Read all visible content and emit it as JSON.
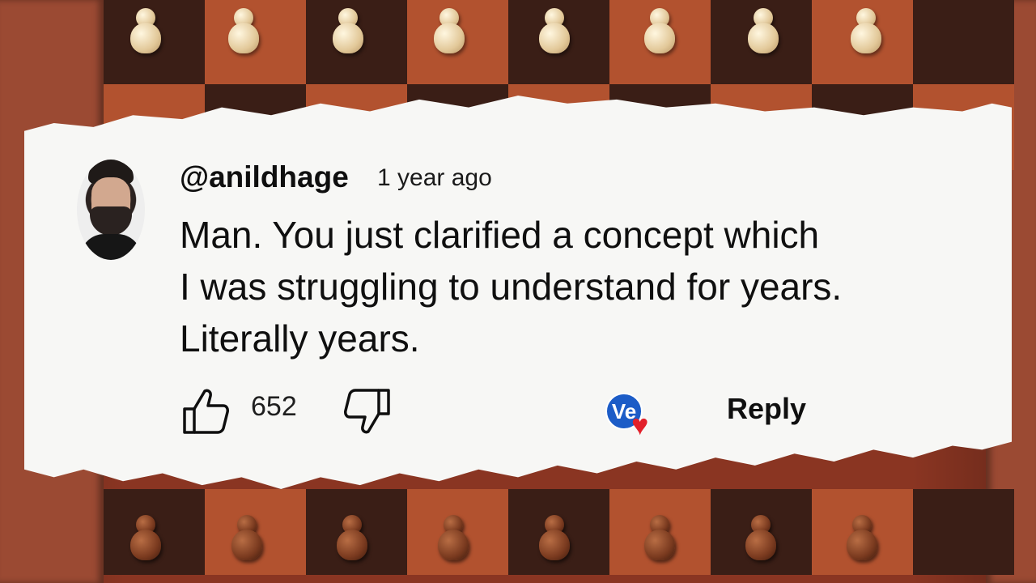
{
  "comment": {
    "author": "@anildhage",
    "time": "1 year ago",
    "text_lines": [
      "Man. You just clarified a concept which",
      "I was struggling to understand for years.",
      "Literally years."
    ],
    "like_count": "652",
    "reply_label": "Reply",
    "creator_badge_letters": "Ve"
  },
  "icons": {
    "like": "thumbs-up-icon",
    "dislike": "thumbs-down-icon",
    "heart": "heart-icon"
  },
  "colors": {
    "heart": "#e2202a",
    "creator_badge": "#1c5cc7",
    "paper": "#f7f7f5"
  }
}
